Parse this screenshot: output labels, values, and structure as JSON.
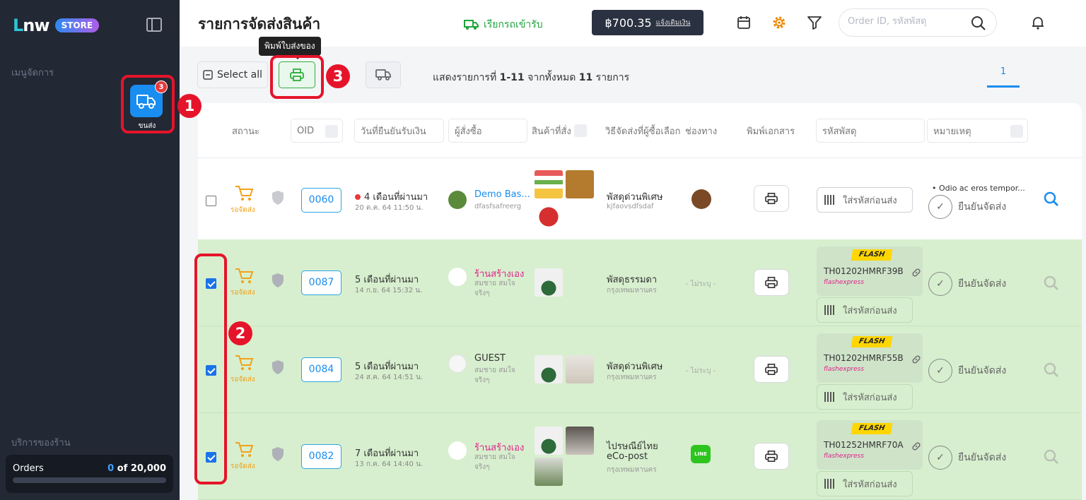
{
  "sidebar": {
    "logo_text": "LNW",
    "logo_badge": "STORE",
    "heading": "เมนูจัดการ",
    "menu_ship_badge": "3",
    "menu_ship_label": "ขนส่ง",
    "service_heading": "บริการของร้าน",
    "orders_label": "Orders",
    "orders_current": "0",
    "orders_total": "of 20,000",
    "orders_progress": 0
  },
  "header": {
    "title": "รายการจัดส่งสินค้า",
    "pickup_label": "เรียกรถเข้ารับ",
    "balance": "฿700.35",
    "topup_label": "แจ้งเติมเงิน",
    "search_placeholder": "Order ID, รหัสพัสดุ"
  },
  "toolbar": {
    "select_all": "Select all",
    "print_tooltip": "พิมพ์ใบส่งของ",
    "showing_prefix": "แสดงรายการที่",
    "showing_range": "1-11",
    "showing_mid": "จากทั้งหมด",
    "showing_total": "11",
    "showing_suffix": "รายการ",
    "page": "1"
  },
  "annotations": {
    "n1": "1",
    "n2": "2",
    "n3": "3"
  },
  "columns": {
    "status": "สถานะ",
    "oid": "OID",
    "paid_date": "วันที่ยืนยันรับเงิน",
    "buyer": "ผู้สั่งซื้อ",
    "products": "สินค้าที่สั่ง",
    "ship_method": "วิธีจัดส่งที่ผู้ซื้อเลือก",
    "channel": "ช่องทาง",
    "print_doc": "พิมพ์เอกสาร",
    "tracking": "รหัสพัสดุ",
    "note": "หมายเหตุ"
  },
  "rows": [
    {
      "checked": false,
      "status": "รอจัดส่ง",
      "oid": "0060",
      "date": "4 เดือนที่ผ่านมา",
      "date_sub": "20 ต.ค. 64 11:50 น.",
      "buyer": "Demo Bas...",
      "buyer_sub": "dfasfsafreerg",
      "ship_method": "พัสดุด่วนพิเศษ",
      "ship_sub": "kjfaovsdfsdaf",
      "channel": "",
      "input_track": "ใส่รหัสก่อนส่ง",
      "note": "Odio ac eros tempor...",
      "confirm": "ยืนยันจัดส่ง"
    },
    {
      "checked": true,
      "status": "รอจัดส่ง",
      "oid": "0087",
      "date": "5 เดือนที่ผ่านมา",
      "date_sub": "14 ก.ย. 64 15:32 น.",
      "buyer": "ร้านสร้างเอง",
      "buyer_sub": "สมชาย สมใจจริงๆ",
      "ship_method": "พัสดุธรรมดา",
      "ship_sub": "กรุงเทพมหานคร",
      "channel": "- ไม่ระบุ -",
      "carrier_logo": "FLASH",
      "tracking": "TH01202HMRF39B",
      "carrier": "flashexpress",
      "input_track": "ใส่รหัสก่อนส่ง",
      "confirm": "ยืนยันจัดส่ง"
    },
    {
      "checked": true,
      "status": "รอจัดส่ง",
      "oid": "0084",
      "date": "5 เดือนที่ผ่านมา",
      "date_sub": "24 ส.ค. 64 14:51 น.",
      "buyer": "GUEST",
      "buyer_sub": "สมชาย สมใจจริงๆ",
      "ship_method": "พัสดุด่วนพิเศษ",
      "ship_sub": "กรุงเทพมหานคร",
      "channel": "- ไม่ระบุ -",
      "carrier_logo": "FLASH",
      "tracking": "TH01202HMRF55B",
      "carrier": "flashexpress",
      "input_track": "ใส่รหัสก่อนส่ง",
      "confirm": "ยืนยันจัดส่ง"
    },
    {
      "checked": true,
      "status": "รอจัดส่ง",
      "oid": "0082",
      "date": "7 เดือนที่ผ่านมา",
      "date_sub": "13 ก.ค. 64 14:40 น.",
      "buyer": "ร้านสร้างเอง",
      "buyer_sub": "สมชาย สมใจจริงๆ",
      "ship_method": "ไปรษณีย์ไทย",
      "ship_method2": "eCo-post",
      "ship_sub": "กรุงเทพมหานคร",
      "channel": "LINE",
      "carrier_logo": "FLASH",
      "tracking": "TH01252HMRF70A",
      "carrier": "flashexpress",
      "input_track": "ใส่รหัสก่อนส่ง",
      "confirm": "ยืนยันจัดส่ง"
    }
  ]
}
